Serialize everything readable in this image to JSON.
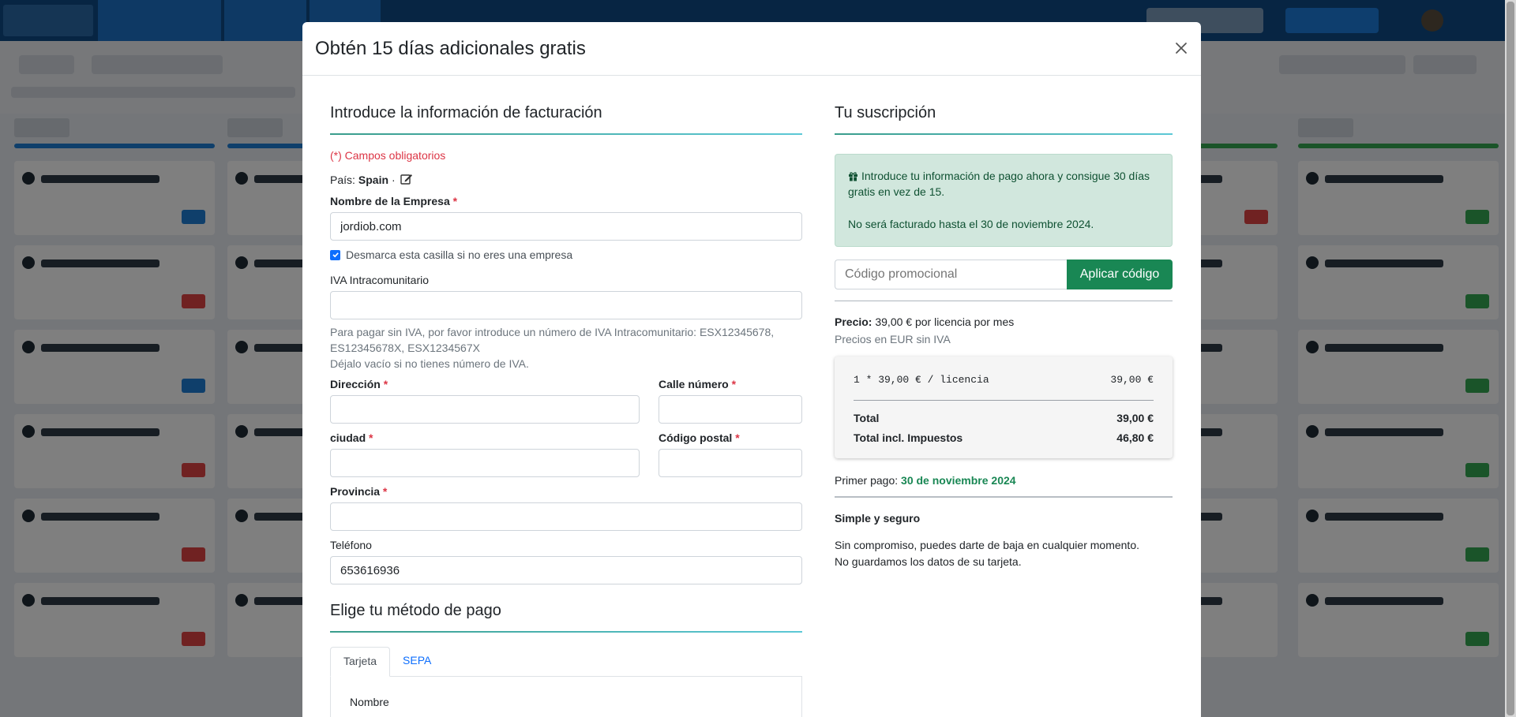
{
  "modal": {
    "title": "Obtén 15 días adicionales gratis"
  },
  "billing": {
    "section_title": "Introduce la información de facturación",
    "required_note": "(*) Campos obligatorios",
    "country_label": "País:",
    "country_value": "Spain",
    "country_sep": "·",
    "company_label": "Nombre de la Empresa",
    "company_value": "jordiob.com",
    "not_company_checkbox_label": "Desmarca esta casilla si no eres una empresa",
    "not_company_checked": true,
    "vat_label": "IVA Intracomunitario",
    "vat_value": "",
    "vat_help_1": "Para pagar sin IVA, por favor introduce un número de IVA Intracomunitario: ESX12345678,",
    "vat_help_2": "ES12345678X, ESX1234567X",
    "vat_help_3": "Déjalo vacío si no tienes número de IVA.",
    "address_label": "Dirección",
    "street_number_label": "Calle número",
    "city_label": "ciudad",
    "postal_label": "Código postal",
    "province_label": "Provincia",
    "phone_label": "Teléfono",
    "phone_value": "653616936",
    "required_mark": "*"
  },
  "payment_method": {
    "section_title": "Elige tu método de pago",
    "tabs": [
      "Tarjeta",
      "SEPA"
    ],
    "active_tab": "Tarjeta",
    "name_field_label": "Nombre"
  },
  "subscription": {
    "section_title": "Tu suscripción",
    "promo_line": "Introduce tu información de pago ahora y consigue 30 días gratis en vez de 15.",
    "billing_date_line": "No será facturado hasta el 30 de noviembre 2024.",
    "coupon_placeholder": "Código promocional",
    "coupon_button": "Aplicar código",
    "price_label": "Precio:",
    "price_value": "39,00 € por licencia por mes",
    "price_note": "Precios en EUR sin IVA",
    "invoice_line_desc": "1 * 39,00 € / licencia",
    "invoice_line_amount": "39,00 €",
    "total_label": "Total",
    "total_value": "39,00 €",
    "total_tax_label": "Total incl. Impuestos",
    "total_tax_value": "46,80 €",
    "first_payment_label": "Primer pago:",
    "first_payment_date": "30 de noviembre 2024",
    "secure_title": "Simple y seguro",
    "secure_line_1": "Sin compromiso, puedes darte de baja en cualquier momento.",
    "secure_line_2": "No guardamos los datos de su tarjeta."
  },
  "colors": {
    "accent_green": "#198754",
    "required_red": "#dc3545",
    "link_blue": "#0d6efd",
    "promo_bg": "#d1e7dd"
  }
}
